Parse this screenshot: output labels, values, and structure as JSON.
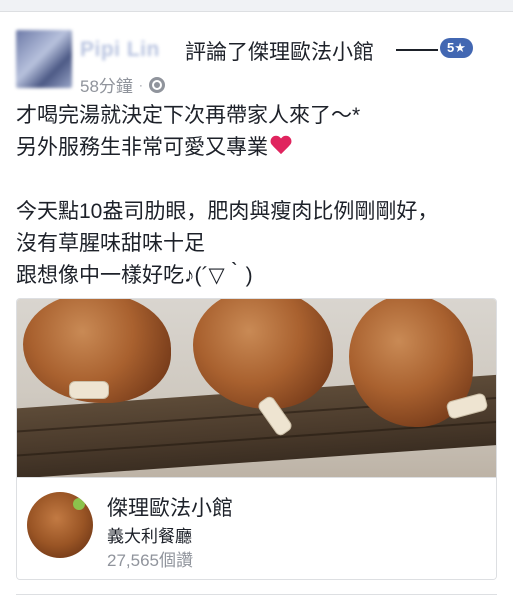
{
  "post": {
    "author": "Pipi Lin",
    "action": "評論了傑理歐法小館",
    "rating": "5★",
    "time": "58分鐘",
    "separator": "·",
    "body_lines": [
      "才喝完湯就決定下次再帶家人來了～*",
      "另外服務生非常可愛又專業",
      "",
      "今天點10盎司肋眼，肥肉與瘦肉比例剛剛好，",
      "沒有草腥味甜味十足",
      "跟想像中一樣好吃♪(´▽｀)"
    ]
  },
  "card": {
    "page_name": "傑理歐法小館",
    "category": "義大利餐廳",
    "likes": "27,565個讚"
  },
  "icons": {
    "privacy": "globe-icon",
    "emoji": "heart-icon"
  },
  "colors": {
    "rating_badge": "#4267b2",
    "meta_text": "#90949c",
    "heart": "#e0245e"
  }
}
